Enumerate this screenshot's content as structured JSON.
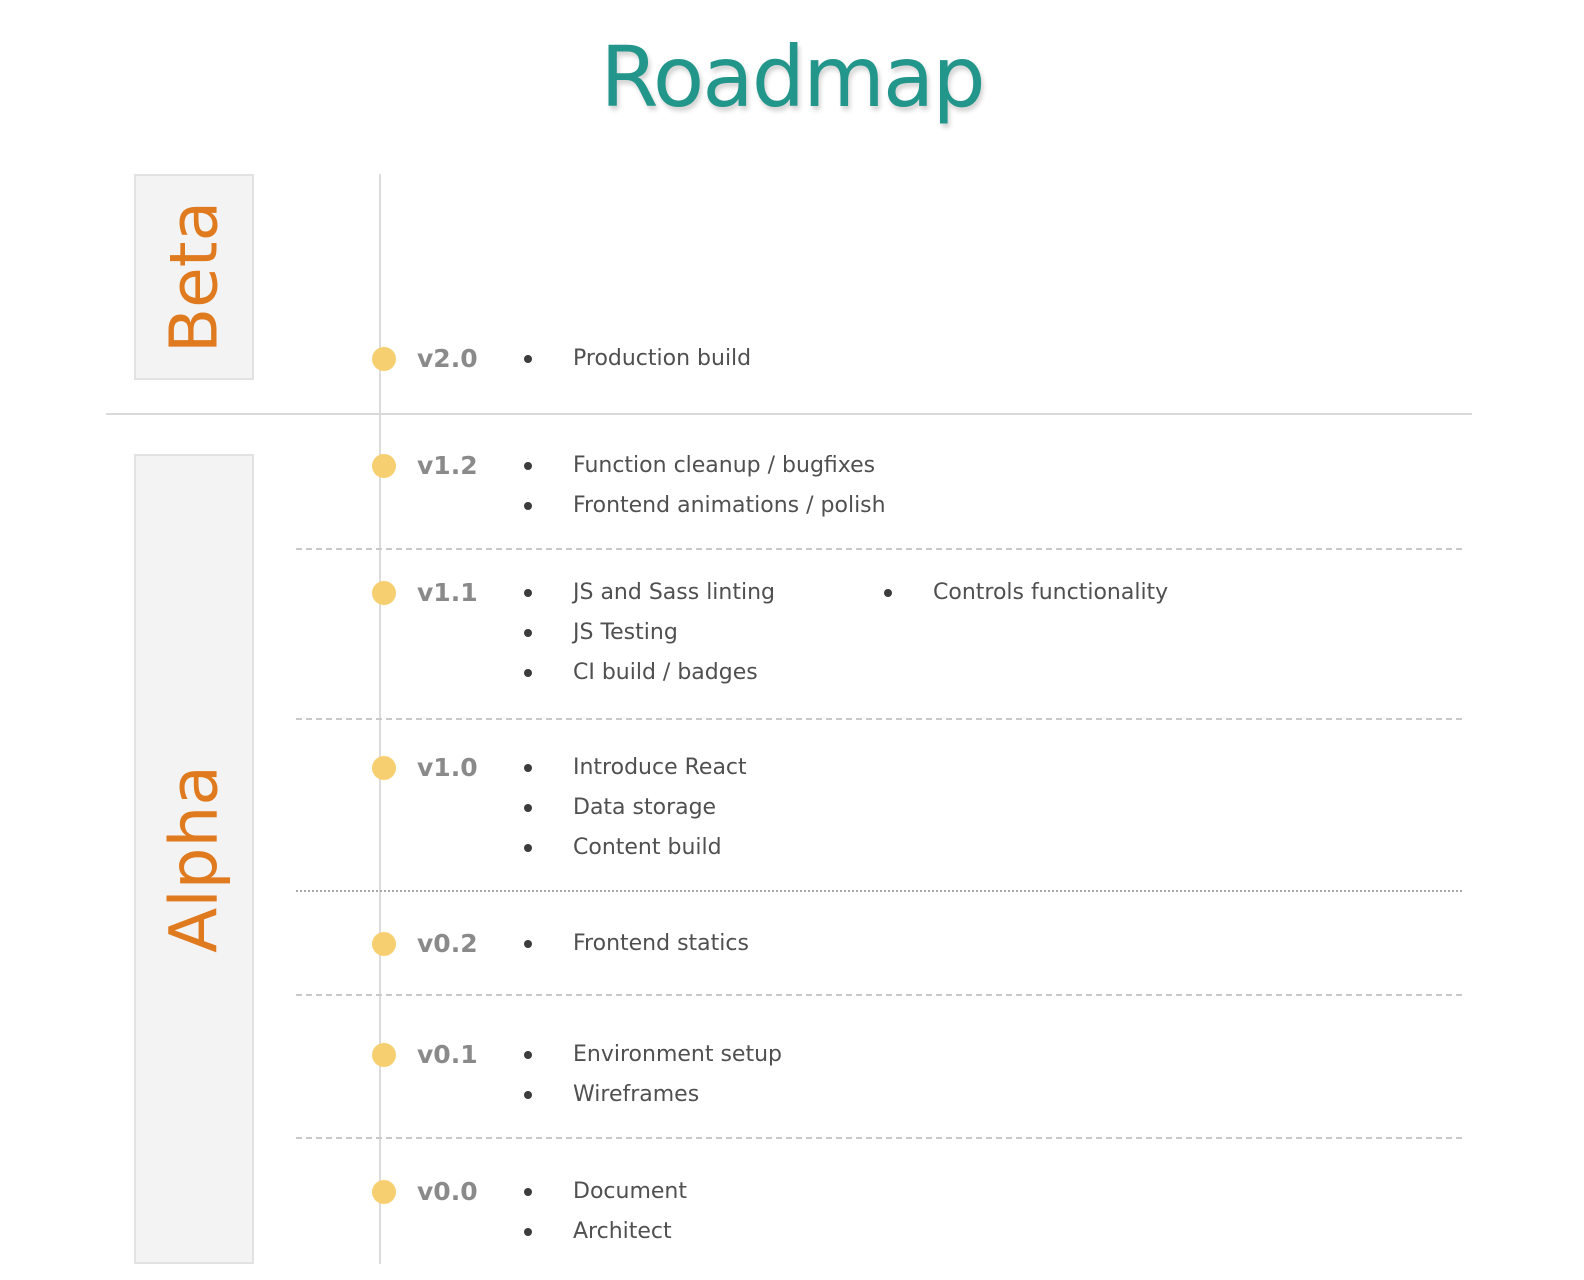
{
  "title": "Roadmap",
  "phases": [
    {
      "label": "Beta"
    },
    {
      "label": "Alpha"
    }
  ],
  "versions": [
    {
      "label": "v2.0",
      "items": [
        "Production build"
      ]
    },
    {
      "label": "v1.2",
      "items": [
        "Function cleanup / bugfixes",
        "Frontend animations / polish"
      ]
    },
    {
      "label": "v1.1",
      "items": [
        "JS and Sass linting",
        "JS Testing",
        "CI build / badges",
        "Controls functionality"
      ]
    },
    {
      "label": "v1.0",
      "items": [
        "Introduce React",
        "Data storage",
        "Content build"
      ]
    },
    {
      "label": "v0.2",
      "items": [
        "Frontend statics"
      ]
    },
    {
      "label": "v0.1",
      "items": [
        "Environment setup",
        "Wireframes"
      ]
    },
    {
      "label": "v0.0",
      "items": [
        "Document",
        "Architect"
      ]
    }
  ],
  "colors": {
    "title": "#22968a",
    "phase_label": "#e07a1f",
    "milestone_dot": "#f5cf70"
  }
}
